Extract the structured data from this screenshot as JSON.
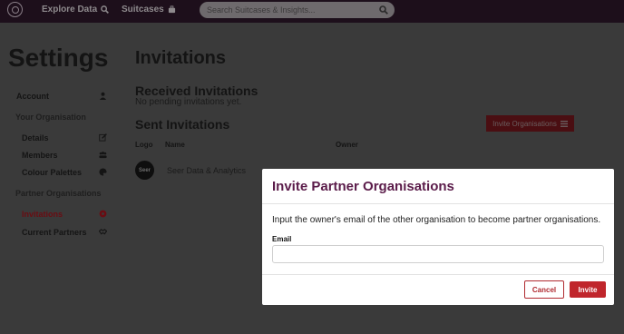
{
  "topbar": {
    "explore_label": "Explore Data",
    "suitcases_label": "Suitcases",
    "search_placeholder": "Search Suitcases & Insights..."
  },
  "sidebar": {
    "title": "Settings",
    "account": "Account",
    "your_org_heading": "Your Organisation",
    "details": "Details",
    "members": "Members",
    "colour_palettes": "Colour Palettes",
    "partner_heading": "Partner Organisations",
    "invitations": "Invitations",
    "current_partners": "Current Partners"
  },
  "main": {
    "title": "Invitations",
    "received_title": "Received Invitations",
    "received_empty": "No pending invitations yet.",
    "sent_title": "Sent Invitations",
    "invite_button": "Invite Organisations",
    "columns": {
      "logo": "Logo",
      "name": "Name",
      "owner": "Owner"
    },
    "rows": [
      {
        "logo_text": "Seer",
        "name": "Seer Data & Analytics"
      }
    ]
  },
  "modal": {
    "title": "Invite Partner Organisations",
    "description": "Input the owner's email of the other organisation to become partner organisations.",
    "email_label": "Email",
    "email_value": "",
    "cancel": "Cancel",
    "invite": "Invite"
  },
  "colors": {
    "topbar_bg": "#1d0f1b",
    "overlay_bg": "#3a3a3a",
    "accent": "#c0262c",
    "modal_title": "#5b1c4a"
  }
}
